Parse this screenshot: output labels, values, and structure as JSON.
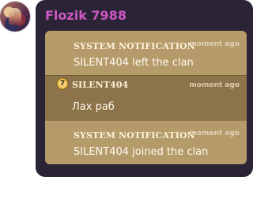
{
  "sender": {
    "name": "Flozik 7988",
    "name_color": "#cc57c3"
  },
  "colors": {
    "bubble_bg": "#2b2436",
    "card_light": "#b59a6a",
    "card_dark": "#8c7349"
  },
  "messages": [
    {
      "header": "SYSTEM NOTIFICATION",
      "time": "moment ago",
      "text": "SILENT404 left the clan"
    },
    {
      "header": "SILENT404",
      "time": "moment ago",
      "text": "Лах раб",
      "level": "7",
      "level_icon": "star-badge-icon"
    },
    {
      "header": "SYSTEM NOTIFICATION",
      "time": "moment ago",
      "text": "SILENT404 joined the clan"
    }
  ]
}
